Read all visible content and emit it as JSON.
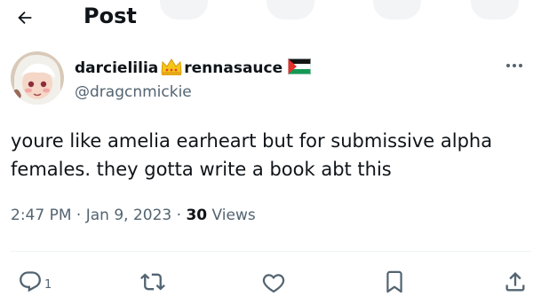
{
  "header": {
    "title": "Post",
    "back_icon": "arrow-left-icon"
  },
  "post": {
    "display_name_prefix": "darcielilia",
    "display_name_suffix": "rennasauce",
    "name_emoji": [
      "crown-emoji",
      "palestine-flag-emoji"
    ],
    "handle": "@dragcnmickie",
    "text": "youre like amelia earheart but for submissive alpha females. they gotta write a book abt this",
    "time": "2:47 PM",
    "separator": "·",
    "date": "Jan 9, 2023",
    "views_count": "30",
    "views_label": "Views"
  },
  "actions": {
    "reply_count": "1",
    "icons": [
      "reply-icon",
      "retweet-icon",
      "like-icon",
      "bookmark-icon",
      "share-icon"
    ]
  },
  "colors": {
    "text": "#0f1419",
    "secondary": "#536471",
    "divider": "#eff3f4"
  }
}
